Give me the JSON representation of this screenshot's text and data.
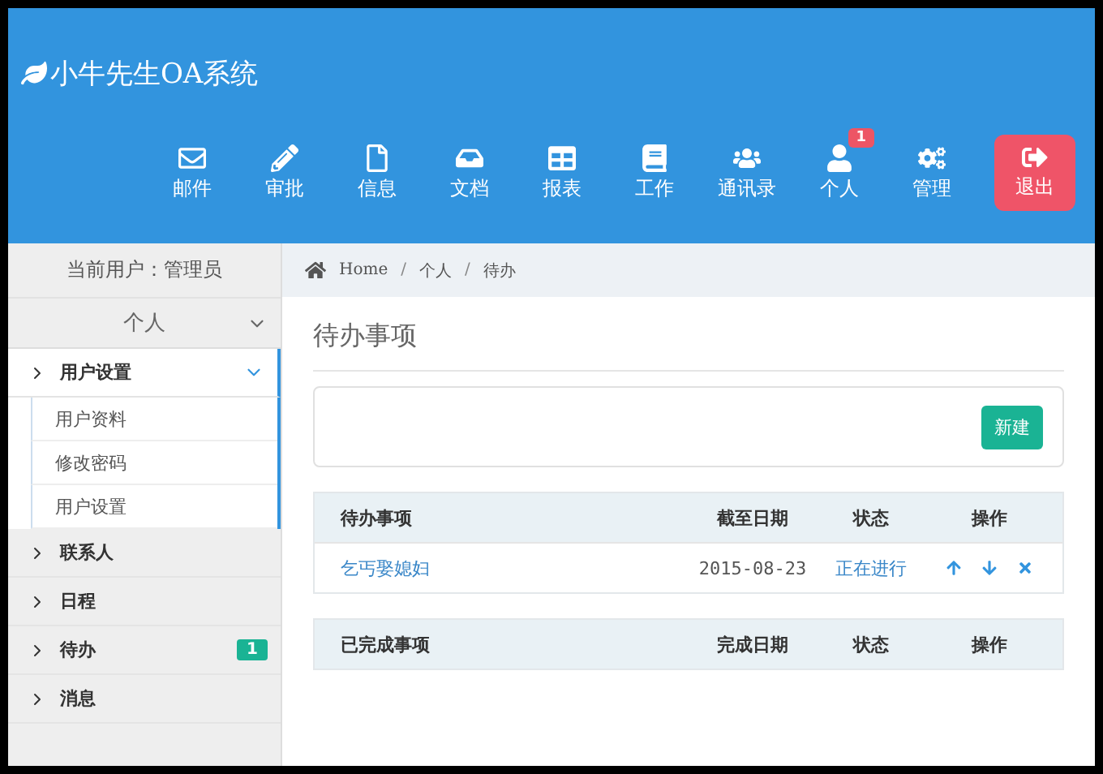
{
  "header": {
    "title": "小牛先生OA系统"
  },
  "nav": [
    {
      "kind": "mail",
      "label": "邮件"
    },
    {
      "kind": "approve",
      "label": "审批"
    },
    {
      "kind": "info",
      "label": "信息"
    },
    {
      "kind": "docs",
      "label": "文档"
    },
    {
      "kind": "report",
      "label": "报表"
    },
    {
      "kind": "work",
      "label": "工作"
    },
    {
      "kind": "contacts",
      "label": "通讯录"
    },
    {
      "kind": "personal",
      "label": "个人",
      "badge": "1"
    },
    {
      "kind": "manage",
      "label": "管理"
    }
  ],
  "logout": {
    "label": "退出"
  },
  "sidebar": {
    "current_user": "当前用户：管理员",
    "section": {
      "label": "个人",
      "expanded": true
    },
    "items": [
      {
        "label": "用户设置",
        "expanded": true,
        "children": [
          {
            "label": "用户资料"
          },
          {
            "label": "修改密码"
          },
          {
            "label": "用户设置"
          }
        ]
      },
      {
        "label": "联系人",
        "expanded": false
      },
      {
        "label": "日程",
        "expanded": false
      },
      {
        "label": "待办",
        "expanded": false,
        "badge": "1"
      },
      {
        "label": "消息",
        "expanded": false
      }
    ]
  },
  "breadcrumb": [
    "Home",
    "个人",
    "待办"
  ],
  "breadcrumb_separator": "/",
  "page_title": "待办事项",
  "new_button": "新建",
  "todo_table": {
    "columns": [
      "待办事项",
      "截至日期",
      "状态",
      "操作"
    ],
    "rows": [
      {
        "title": "乞丐娶媳妇",
        "date": "2015-08-23",
        "status": "正在进行"
      }
    ]
  },
  "done_table": {
    "columns": [
      "已完成事项",
      "完成日期",
      "状态",
      "操作"
    ]
  }
}
